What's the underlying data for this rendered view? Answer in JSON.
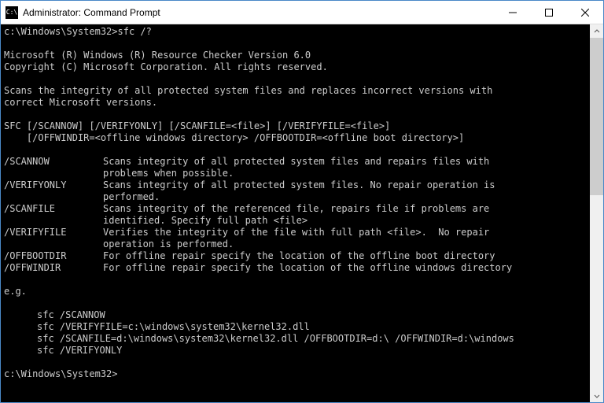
{
  "window": {
    "title": "Administrator: Command Prompt",
    "icon_label": "C:\\"
  },
  "prompt1": "c:\\Windows\\System32>",
  "command": "sfc /?",
  "blank": "",
  "header_line1": "Microsoft (R) Windows (R) Resource Checker Version 6.0",
  "header_line2": "Copyright (C) Microsoft Corporation. All rights reserved.",
  "desc_line1": "Scans the integrity of all protected system files and replaces incorrect versions with",
  "desc_line2": "correct Microsoft versions.",
  "usage_line1": "SFC [/SCANNOW] [/VERIFYONLY] [/SCANFILE=<file>] [/VERIFYFILE=<file>]",
  "usage_line2": "    [/OFFWINDIR=<offline windows directory> /OFFBOOTDIR=<offline boot directory>]",
  "options": [
    {
      "name": "/SCANNOW",
      "desc": "Scans integrity of all protected system files and repairs files with\nproblems when possible."
    },
    {
      "name": "/VERIFYONLY",
      "desc": "Scans integrity of all protected system files. No repair operation is\nperformed."
    },
    {
      "name": "/SCANFILE",
      "desc": "Scans integrity of the referenced file, repairs file if problems are\nidentified. Specify full path <file>"
    },
    {
      "name": "/VERIFYFILE",
      "desc": "Verifies the integrity of the file with full path <file>.  No repair\noperation is performed."
    },
    {
      "name": "/OFFBOOTDIR",
      "desc": "For offline repair specify the location of the offline boot directory"
    },
    {
      "name": "/OFFWINDIR",
      "desc": "For offline repair specify the location of the offline windows directory"
    }
  ],
  "examples_header": "e.g.",
  "examples": [
    "sfc /SCANNOW",
    "sfc /VERIFYFILE=c:\\windows\\system32\\kernel32.dll",
    "sfc /SCANFILE=d:\\windows\\system32\\kernel32.dll /OFFBOOTDIR=d:\\ /OFFWINDIR=d:\\windows",
    "sfc /VERIFYONLY"
  ],
  "prompt2": "c:\\Windows\\System32>"
}
